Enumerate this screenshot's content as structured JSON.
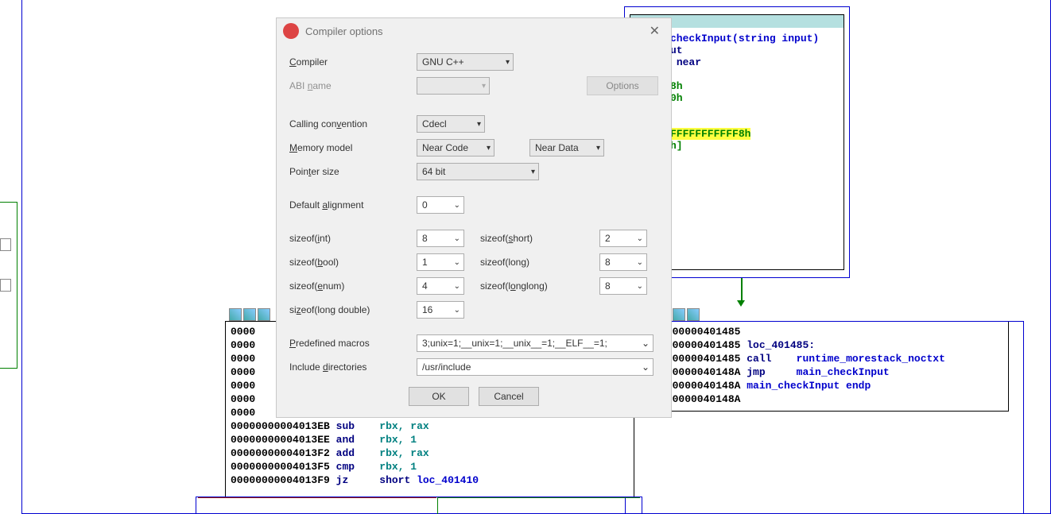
{
  "dialog": {
    "title": "Compiler options",
    "labels": {
      "compiler": "Compiler",
      "abi_name": "ABI name",
      "options_btn": "Options",
      "calling_convention": "Calling convention",
      "memory_model": "Memory model",
      "pointer_size": "Pointer size",
      "default_alignment": "Default alignment",
      "sizeof_int": "sizeof(int)",
      "sizeof_short": "sizeof(short)",
      "sizeof_bool": "sizeof(bool)",
      "sizeof_long": "sizeof(long)",
      "sizeof_enum": "sizeof(enum)",
      "sizeof_longlong": "sizeof(longlong)",
      "sizeof_long_double": "sizeof(long double)",
      "predefined_macros": "Predefined macros",
      "include_directories": "Include directories",
      "ok": "OK",
      "cancel": "Cancel"
    },
    "values": {
      "compiler": "GNU C++",
      "abi_name": "",
      "calling_convention": "Cdecl",
      "mm_code": "Near Code",
      "mm_data": "Near Data",
      "pointer_size": "64 bit",
      "default_alignment": "0",
      "sizeof_int": "8",
      "sizeof_short": "2",
      "sizeof_bool": "1",
      "sizeof_long": "8",
      "sizeof_enum": "4",
      "sizeof_longlong": "8",
      "sizeof_long_double": "16",
      "predefined_macros": "3;unix=1;__unix=1;__unix__=1;__ELF__=1;",
      "include_directories": "/usr/include"
    }
  },
  "top_node": {
    "sig": "checkInput(string input)",
    "kw_ut": "ut",
    "kw_near": "near",
    "v1": "8h",
    "v2": "0h",
    "hl": "FFFFFFFFFFF8h",
    "suffix": "h]"
  },
  "right_node": {
    "a0": "0000000401485",
    "a1": "0000000401485",
    "a2": "0000000401485",
    "a3": "000000040148A",
    "a4": "000000040148A",
    "a5": "000000040148A",
    "loc": "loc_401485:",
    "i_call": "call",
    "i_jmp": "jmp",
    "f_morestack": "runtime_morestack_noctxt",
    "f_main": "main_checkInput",
    "endp": "main_checkInput endp"
  },
  "left_node": {
    "addr_prefix": "0000000000",
    "rows": [
      {
        "a": "00000000004013EB",
        "m": "sub",
        "o": "rbx, rax"
      },
      {
        "a": "00000000004013EE",
        "m": "and",
        "o": "rbx, 1"
      },
      {
        "a": "00000000004013F2",
        "m": "add",
        "o": "rbx, rax"
      },
      {
        "a": "00000000004013F5",
        "m": "cmp",
        "o": "rbx, 1"
      },
      {
        "a": "00000000004013F9",
        "m": "jz",
        "o": "short loc_401410"
      }
    ]
  }
}
